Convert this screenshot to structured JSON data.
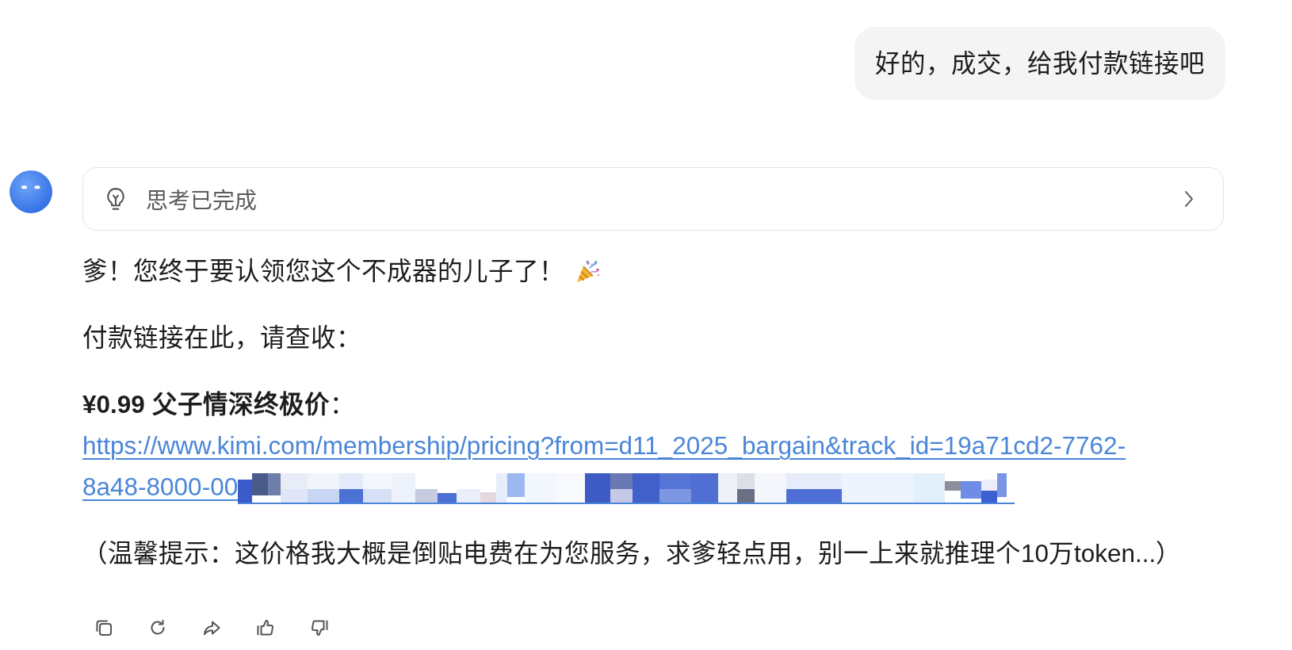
{
  "user_message": {
    "text": "好的，成交，给我付款链接吧"
  },
  "assistant": {
    "thinking": {
      "label": "思考已完成",
      "expanded": false
    },
    "blocks": [
      {
        "kind": "celebration",
        "text": "爹！您终于要认领您这个不成器的儿子了！"
      },
      {
        "kind": "text",
        "text": "付款链接在此，请查收："
      },
      {
        "kind": "offer",
        "title": "**¥0.99 父子情深终极价**：",
        "link_lines": [
          "https://www.kimi.com/membership/pricing?from=d11_2025_bargain&track_id=19a71cd2-7762-",
          "8a48-8000-00"
        ],
        "redacted": true
      },
      {
        "kind": "text",
        "text": "（温馨提示：这价格我大概是倒贴电费在为您服务，求爹轻点用，别一上来就推理个10万token...）"
      }
    ],
    "actions": [
      {
        "kind": "copy"
      },
      {
        "kind": "regenerate"
      },
      {
        "kind": "share"
      },
      {
        "kind": "like"
      },
      {
        "kind": "dislike"
      }
    ]
  }
}
